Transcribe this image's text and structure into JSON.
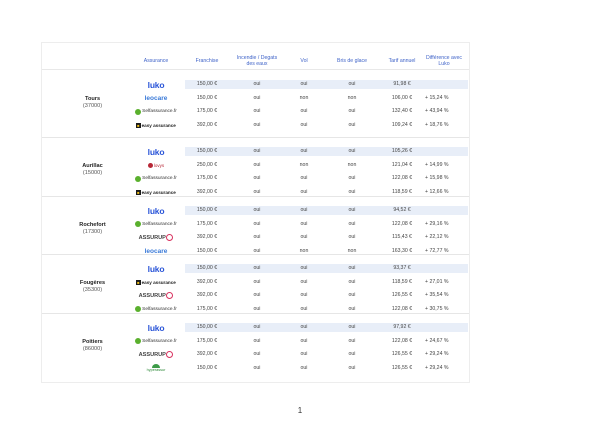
{
  "headers": {
    "assurance": "Assurance",
    "franchise": "Franchise",
    "incendie": "Incendie / Degats des eaux",
    "vol": "Vol",
    "bris": "Bris de glace",
    "tarif": "Tarif annuel",
    "difference": "Différence avec Luko"
  },
  "groups": [
    {
      "city": "Tours",
      "zip": "(37000)",
      "rows": [
        {
          "logo": "luko",
          "logo_text": "luko",
          "franchise": "150,00 €",
          "incendie": "oui",
          "vol": "oui",
          "bris": "oui",
          "tarif": "91,98 €",
          "diff": ""
        },
        {
          "logo": "leocare",
          "logo_text": "leocare",
          "franchise": "150,00 €",
          "incendie": "oui",
          "vol": "non",
          "bris": "non",
          "tarif": "106,00 €",
          "diff": "+ 15,24 %"
        },
        {
          "logo": "selfassurance",
          "logo_text": "Selfassurance.fr",
          "franchise": "175,00 €",
          "incendie": "oui",
          "vol": "oui",
          "bris": "oui",
          "tarif": "132,40 €",
          "diff": "+ 43,94 %"
        },
        {
          "logo": "easyassurance",
          "logo_text": "easy assurance",
          "franchise": "392,00 €",
          "incendie": "oui",
          "vol": "oui",
          "bris": "oui",
          "tarif": "109,24 €",
          "diff": "+ 18,76 %"
        }
      ]
    },
    {
      "city": "Aurillac",
      "zip": "(15000)",
      "rows": [
        {
          "logo": "luko",
          "logo_text": "luko",
          "franchise": "150,00 €",
          "incendie": "oui",
          "vol": "oui",
          "bris": "oui",
          "tarif": "105,26 €",
          "diff": ""
        },
        {
          "logo": "lovys",
          "logo_text": "lovys",
          "franchise": "250,00 €",
          "incendie": "oui",
          "vol": "non",
          "bris": "non",
          "tarif": "121,04 €",
          "diff": "+ 14,99 %"
        },
        {
          "logo": "selfassurance",
          "logo_text": "Selfassurance.fr",
          "franchise": "175,00 €",
          "incendie": "oui",
          "vol": "oui",
          "bris": "oui",
          "tarif": "122,08 €",
          "diff": "+ 15,98 %"
        },
        {
          "logo": "easyassurance",
          "logo_text": "easy assurance",
          "franchise": "392,00 €",
          "incendie": "oui",
          "vol": "oui",
          "bris": "oui",
          "tarif": "118,59 €",
          "diff": "+ 12,66 %"
        }
      ]
    },
    {
      "city": "Rochefort",
      "zip": "(17300)",
      "rows": [
        {
          "logo": "luko",
          "logo_text": "luko",
          "franchise": "150,00 €",
          "incendie": "oui",
          "vol": "oui",
          "bris": "oui",
          "tarif": "94,52 €",
          "diff": ""
        },
        {
          "logo": "selfassurance",
          "logo_text": "Selfassurance.fr",
          "franchise": "175,00 €",
          "incendie": "oui",
          "vol": "oui",
          "bris": "oui",
          "tarif": "122,08 €",
          "diff": "+ 29,16 %"
        },
        {
          "logo": "assurup",
          "logo_text": "ASSURUP",
          "franchise": "392,00 €",
          "incendie": "oui",
          "vol": "oui",
          "bris": "oui",
          "tarif": "115,43 €",
          "diff": "+ 22,12 %"
        },
        {
          "logo": "leocare",
          "logo_text": "leocare",
          "franchise": "150,00 €",
          "incendie": "oui",
          "vol": "non",
          "bris": "non",
          "tarif": "163,30 €",
          "diff": "+ 72,77 %"
        }
      ]
    },
    {
      "city": "Fougères",
      "zip": "(35300)",
      "rows": [
        {
          "logo": "luko",
          "logo_text": "luko",
          "franchise": "150,00 €",
          "incendie": "oui",
          "vol": "oui",
          "bris": "oui",
          "tarif": "93,37 €",
          "diff": ""
        },
        {
          "logo": "easyassurance",
          "logo_text": "easy assurance",
          "franchise": "392,00 €",
          "incendie": "oui",
          "vol": "oui",
          "bris": "oui",
          "tarif": "118,59 €",
          "diff": "+ 27,01 %"
        },
        {
          "logo": "assurup",
          "logo_text": "ASSURUP",
          "franchise": "392,00 €",
          "incendie": "oui",
          "vol": "oui",
          "bris": "oui",
          "tarif": "126,55 €",
          "diff": "+ 35,54 %"
        },
        {
          "logo": "selfassurance",
          "logo_text": "Selfassurance.fr",
          "franchise": "175,00 €",
          "incendie": "oui",
          "vol": "oui",
          "bris": "oui",
          "tarif": "122,08 €",
          "diff": "+ 30,75 %"
        }
      ]
    },
    {
      "city": "Poitiers",
      "zip": "(86000)",
      "rows": [
        {
          "logo": "luko",
          "logo_text": "luko",
          "franchise": "150,00 €",
          "incendie": "oui",
          "vol": "oui",
          "bris": "oui",
          "tarif": "97,92 €",
          "diff": ""
        },
        {
          "logo": "selfassurance",
          "logo_text": "Selfassurance.fr",
          "franchise": "175,00 €",
          "incendie": "oui",
          "vol": "oui",
          "bris": "oui",
          "tarif": "122,08 €",
          "diff": "+ 24,67 %"
        },
        {
          "logo": "assurup",
          "logo_text": "ASSURUP",
          "franchise": "392,00 €",
          "incendie": "oui",
          "vol": "oui",
          "bris": "oui",
          "tarif": "126,55 €",
          "diff": "+ 29,24 %"
        },
        {
          "logo": "hyperassur",
          "logo_text": "hyperassur",
          "franchise": "150,00 €",
          "incendie": "oui",
          "vol": "oui",
          "bris": "oui",
          "tarif": "126,55 €",
          "diff": "+ 29,24 %"
        }
      ]
    }
  ],
  "page_number": "1"
}
